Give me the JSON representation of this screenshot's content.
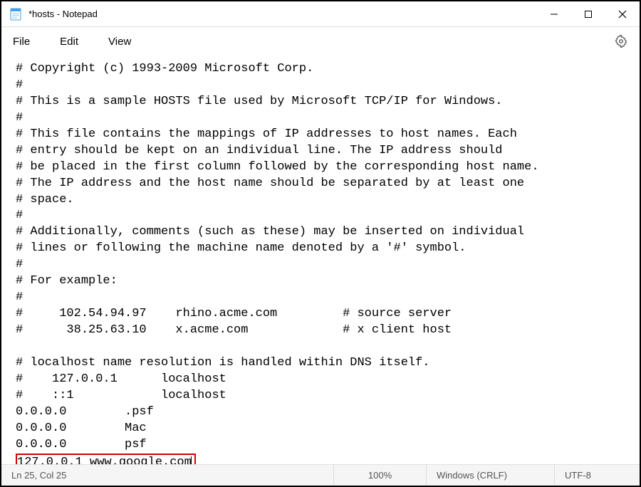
{
  "title_bar": {
    "title": "*hosts - Notepad"
  },
  "menu": {
    "file": "File",
    "edit": "Edit",
    "view": "View"
  },
  "content": {
    "lines": [
      "# Copyright (c) 1993-2009 Microsoft Corp.",
      "#",
      "# This is a sample HOSTS file used by Microsoft TCP/IP for Windows.",
      "#",
      "# This file contains the mappings of IP addresses to host names. Each",
      "# entry should be kept on an individual line. The IP address should",
      "# be placed in the first column followed by the corresponding host name.",
      "# The IP address and the host name should be separated by at least one",
      "# space.",
      "#",
      "# Additionally, comments (such as these) may be inserted on individual",
      "# lines or following the machine name denoted by a '#' symbol.",
      "#",
      "# For example:",
      "#",
      "#     102.54.94.97    rhino.acme.com         # source server",
      "#      38.25.63.10    x.acme.com             # x client host",
      "",
      "# localhost name resolution is handled within DNS itself.",
      "#    127.0.0.1      localhost",
      "#    ::1            localhost",
      "0.0.0.0        .psf",
      "0.0.0.0        Mac",
      "0.0.0.0        psf"
    ],
    "highlighted_line": "127.0.0.1 www.google.com"
  },
  "status": {
    "position": "Ln 25, Col 25",
    "zoom": "100%",
    "eol": "Windows (CRLF)",
    "encoding": "UTF-8"
  }
}
